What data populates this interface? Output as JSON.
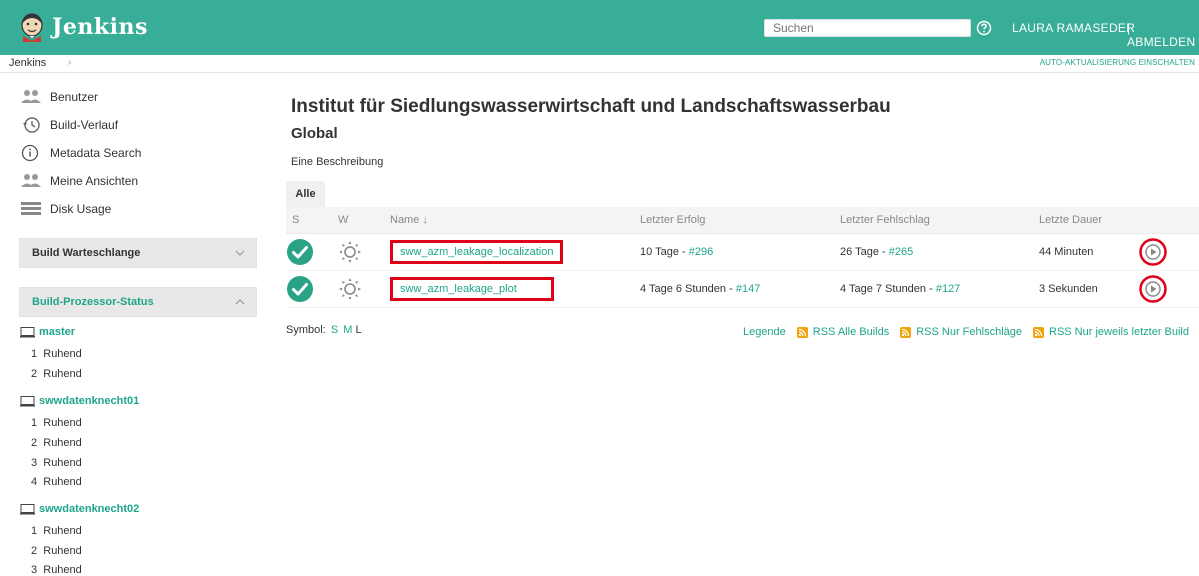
{
  "header": {
    "brand": "Jenkins",
    "search_placeholder": "Suchen",
    "user": "LAURA RAMASEDER",
    "logout": "| ABMELDEN",
    "accent": "#38ad97"
  },
  "breadcrumb": {
    "root": "Jenkins",
    "separator": "›",
    "auto_refresh": "AUTO-AKTUALISIERUNG EINSCHALTEN"
  },
  "sidebar": {
    "tasks": [
      {
        "label": "Benutzer",
        "icon": "people-icon"
      },
      {
        "label": "Build-Verlauf",
        "icon": "history-icon"
      },
      {
        "label": "Metadata Search",
        "icon": "info-icon"
      },
      {
        "label": "Meine Ansichten",
        "icon": "people-icon"
      },
      {
        "label": "Disk Usage",
        "icon": "disk-icon"
      }
    ],
    "build_queue": {
      "title": "Build Warteschlange",
      "state": "collapsed"
    },
    "executors": {
      "title": "Build-Prozessor-Status",
      "state": "expanded",
      "nodes": [
        {
          "name": "master",
          "executors": [
            {
              "num": "1",
              "status": "Ruhend"
            },
            {
              "num": "2",
              "status": "Ruhend"
            }
          ]
        },
        {
          "name": "swwdatenknecht01",
          "executors": [
            {
              "num": "1",
              "status": "Ruhend"
            },
            {
              "num": "2",
              "status": "Ruhend"
            },
            {
              "num": "3",
              "status": "Ruhend"
            },
            {
              "num": "4",
              "status": "Ruhend"
            }
          ]
        },
        {
          "name": "swwdatenknecht02",
          "executors": [
            {
              "num": "1",
              "status": "Ruhend"
            },
            {
              "num": "2",
              "status": "Ruhend"
            },
            {
              "num": "3",
              "status": "Ruhend"
            }
          ]
        }
      ]
    }
  },
  "main": {
    "title": "Institut für Siedlungswasserwirtschaft und Landschaftswasserbau",
    "view_name": "Global",
    "description": "Eine Beschreibung",
    "tabs": [
      {
        "label": "Alle",
        "active": true
      }
    ],
    "table": {
      "columns": {
        "s": "S",
        "w": "W",
        "name": "Name ↓",
        "last_success": "Letzter Erfolg",
        "last_failure": "Letzter Fehlschlag",
        "last_duration": "Letzte Dauer"
      },
      "rows": [
        {
          "status": "success",
          "weather": "sunny",
          "name": "sww_azm_leakage_localization",
          "last_success_text": "10 Tage - ",
          "last_success_build": "#296",
          "last_failure_text": "26 Tage - ",
          "last_failure_build": "#265",
          "duration": "44 Minuten"
        },
        {
          "status": "success",
          "weather": "sunny",
          "name": "sww_azm_leakage_plot",
          "last_success_text": "4 Tage 6 Stunden - ",
          "last_success_build": "#147",
          "last_failure_text": "4 Tage 7 Stunden - ",
          "last_failure_build": "#127",
          "duration": "3 Sekunden"
        }
      ]
    },
    "icon_sizes": {
      "label": "Symbol:",
      "s": "S",
      "m": "M",
      "l": "L"
    },
    "footer_links": {
      "legend": "Legende",
      "rss_all": "RSS Alle Builds",
      "rss_failures": "RSS Nur Fehlschläge",
      "rss_latest": "RSS Nur jeweils letzter Build"
    }
  }
}
